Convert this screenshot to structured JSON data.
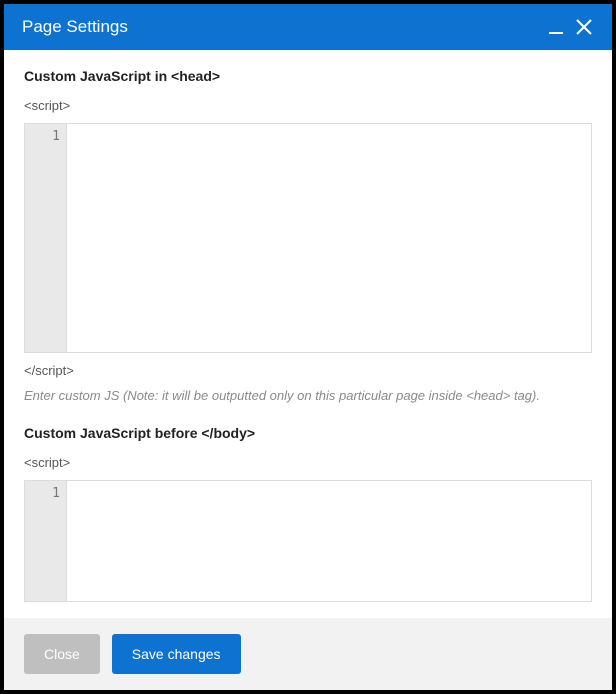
{
  "window": {
    "title": "Page Settings"
  },
  "sections": {
    "head": {
      "title": "Custom JavaScript in <head>",
      "open_tag": "<script>",
      "close_tag": "</script>",
      "line_number": "1",
      "value": "",
      "help": "Enter custom JS (Note: it will be outputted only on this particular page inside <head> tag)."
    },
    "body": {
      "title": "Custom JavaScript before </body>",
      "open_tag": "<script>",
      "line_number": "1",
      "value": ""
    }
  },
  "footer": {
    "close_label": "Close",
    "save_label": "Save changes"
  }
}
